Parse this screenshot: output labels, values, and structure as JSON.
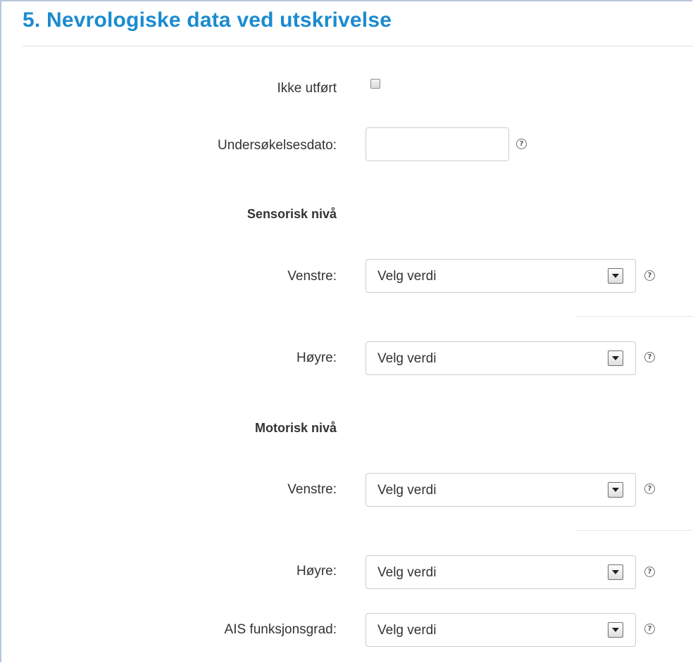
{
  "section": {
    "title": "5. Nevrologiske data ved utskrivelse"
  },
  "form": {
    "not_done_label": "Ikke utført",
    "not_done_checked": false,
    "exam_date_label": "Undersøkelsesdato:",
    "exam_date_value": "",
    "sensory_heading": "Sensorisk nivå",
    "sensory_left_label": "Venstre:",
    "sensory_left_value": "Velg verdi",
    "sensory_right_label": "Høyre:",
    "sensory_right_value": "Velg verdi",
    "motor_heading": "Motorisk nivå",
    "motor_left_label": "Venstre:",
    "motor_left_value": "Velg verdi",
    "motor_right_label": "Høyre:",
    "motor_right_value": "Velg verdi",
    "ais_label": "AIS funksjonsgrad:",
    "ais_value": "Velg verdi",
    "help_glyph": "?"
  },
  "icons": {
    "calendar": "calendar-icon",
    "help": "help-icon",
    "dropdown": "chevron-down-icon"
  },
  "colors": {
    "title": "#1b8bd0",
    "text": "#333333",
    "border": "#cccccc",
    "frame": "#b7c7dc"
  }
}
